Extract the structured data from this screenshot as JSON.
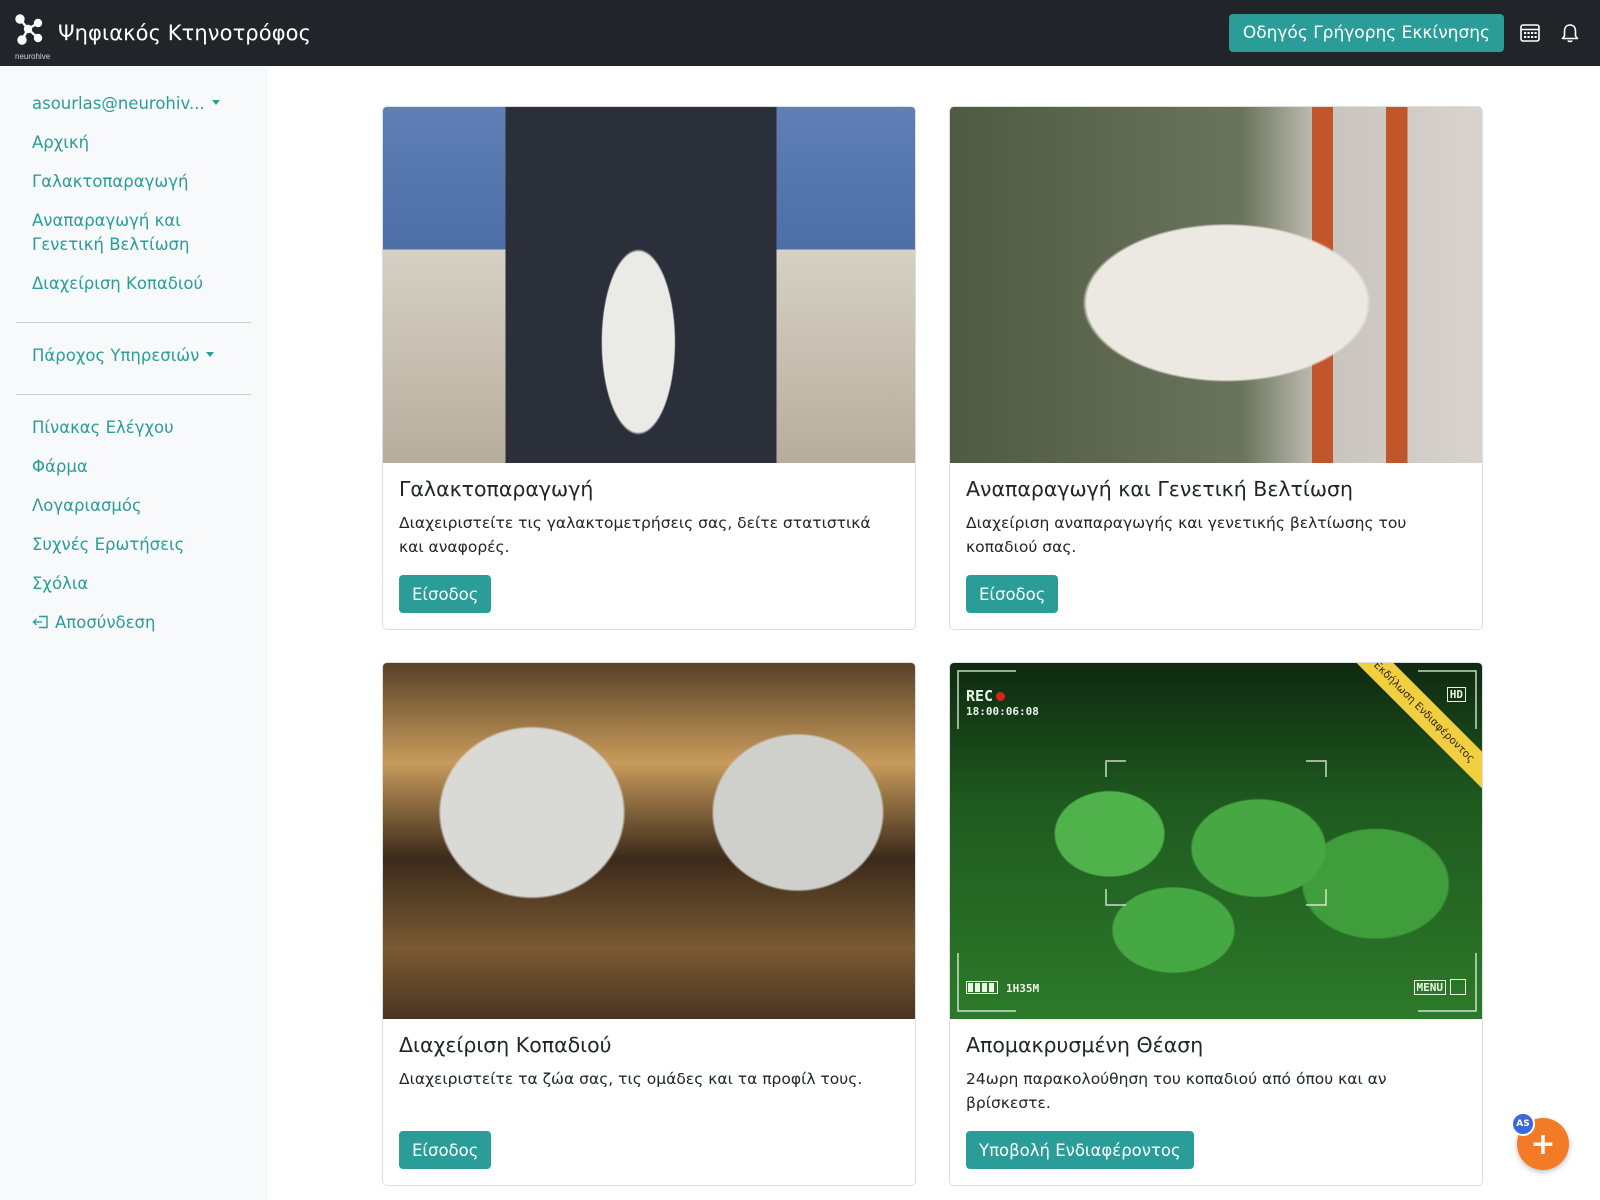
{
  "header": {
    "logo_text": "neurohive",
    "app_title": "Ψηφιακός Κτηνοτρόφος",
    "quickstart_label": "Οδηγός Γρήγορης Εκκίνησης",
    "calendar_icon": "calendar-icon",
    "bell_icon": "bell-icon"
  },
  "sidebar": {
    "user": "asourlas@neurohiv...",
    "main_links": [
      {
        "label": "Αρχική"
      },
      {
        "label": "Γαλακτοπαραγωγή"
      },
      {
        "label": "Αναπαραγωγή και Γενετική Βελτίωση"
      },
      {
        "label": "Διαχείριση Κοπαδιού"
      }
    ],
    "provider_label": "Πάροχος Υπηρεσιών",
    "bottom_links": [
      {
        "label": "Πίνακας Ελέγχου"
      },
      {
        "label": "Φάρμα"
      },
      {
        "label": "Λογαριασμός"
      },
      {
        "label": "Συχνές Ερωτήσεις"
      },
      {
        "label": "Σχόλια"
      }
    ],
    "logout_label": "Αποσύνδεση"
  },
  "cards": [
    {
      "title": "Γαλακτοπαραγωγή",
      "text": "Διαχειριστείτε τις γαλακτομετρήσεις σας, δείτε στατιστικά και αναφορές.",
      "button": "Είσοδος"
    },
    {
      "title": "Αναπαραγωγή και Γενετική Βελτίωση",
      "text": "Διαχείριση αναπαραγωγής και γενετικής βελτίωσης του κοπαδιού σας.",
      "button": "Είσοδος"
    },
    {
      "title": "Διαχείριση Κοπαδιού",
      "text": "Διαχειριστείτε τα ζώα σας, τις ομάδες και τα προφίλ τους.",
      "button": "Είσοδος"
    },
    {
      "title": "Απομακρυσμένη Θέαση",
      "text": "24ωρη παρακολούθηση του κοπαδιού από όπου και αν βρίσκεστε.",
      "button": "Υποβολή Ενδιαφέροντος",
      "ribbon": "Εκδήλωση Ενδιαφέροντος",
      "camera": {
        "rec": "REC",
        "time": "18:00:06:08",
        "battery_time": "1H35M",
        "menu": "MENU",
        "hd": "HD"
      }
    }
  ],
  "fab": {
    "plus": "+",
    "badge": "AS"
  },
  "colors": {
    "accent": "#2a9d99",
    "navbar": "#212529",
    "fab": "#f47b25",
    "badge": "#3d68d8",
    "ribbon": "#f2cf3f"
  }
}
